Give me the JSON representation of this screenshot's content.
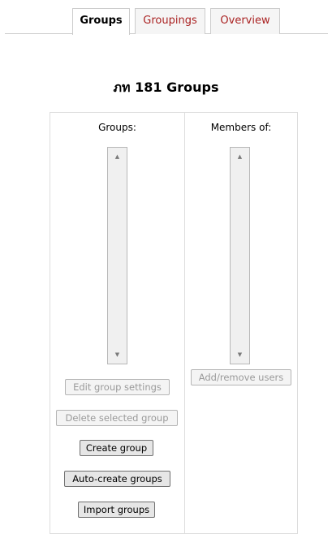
{
  "tabs": [
    {
      "label": "Groups",
      "active": true
    },
    {
      "label": "Groupings",
      "active": false
    },
    {
      "label": "Overview",
      "active": false
    }
  ],
  "page_title": "ภท 181 Groups",
  "groups_column": {
    "label": "Groups:",
    "buttons": {
      "edit": "Edit group settings",
      "delete": "Delete selected group",
      "create": "Create group",
      "auto_create": "Auto-create groups",
      "import": "Import groups"
    }
  },
  "members_column": {
    "label": "Members of:",
    "buttons": {
      "add_remove": "Add/remove users"
    }
  },
  "colors": {
    "tab_inactive_text": "#aa2222",
    "border": "#cccccc",
    "disabled_text": "#9a9a9a"
  },
  "icons": {
    "scroll_up": "triangle-up",
    "scroll_down": "triangle-down"
  }
}
